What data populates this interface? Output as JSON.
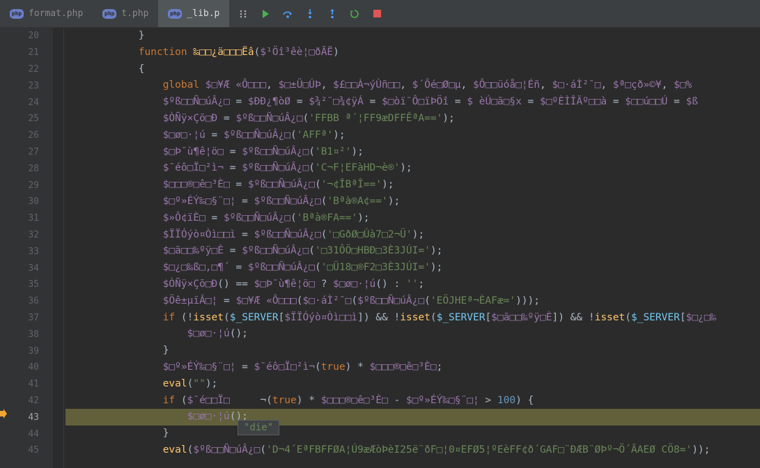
{
  "tabs": [
    {
      "label": "format.php",
      "active": false
    },
    {
      "label": "t.php",
      "active": false
    },
    {
      "label": "_lib.p",
      "active": true
    }
  ],
  "toolbar": {
    "drag": "drag-handle",
    "play": "play",
    "step_over": "step-over",
    "step_into": "step-into",
    "step_out": "step-out",
    "restart": "restart",
    "stop": "stop"
  },
  "gutter_start": 20,
  "current_line": 43,
  "tooltip": "\"die\"",
  "lines": [
    {
      "n": 20,
      "indent": 3,
      "tokens": [
        {
          "t": "}",
          "c": "plain"
        }
      ]
    },
    {
      "n": 21,
      "indent": 3,
      "tokens": [
        {
          "t": "function ",
          "c": "k-keyword"
        },
        {
          "t": "‰□□¿ä□□□Ëâ",
          "c": "k-func"
        },
        {
          "t": "(",
          "c": "plain"
        },
        {
          "t": "$¹Öî³êè¦□ðÃË",
          "c": "k-var"
        },
        {
          "t": ")",
          "c": "plain"
        }
      ]
    },
    {
      "n": 22,
      "indent": 3,
      "tokens": [
        {
          "t": "{",
          "c": "plain"
        }
      ]
    },
    {
      "n": 23,
      "indent": 4,
      "tokens": [
        {
          "t": "global ",
          "c": "k-keyword"
        },
        {
          "t": "$□¥Æ «Ô□□□",
          "c": "k-var"
        },
        {
          "t": ", ",
          "c": "plain"
        },
        {
          "t": "$□±Ü□ÚÞ",
          "c": "k-var"
        },
        {
          "t": ", ",
          "c": "plain"
        },
        {
          "t": "$£□□À¬ýÙñ□□",
          "c": "k-var"
        },
        {
          "t": ", ",
          "c": "plain"
        },
        {
          "t": "$´Ôé□Ø□µ",
          "c": "k-var"
        },
        {
          "t": ", ",
          "c": "plain"
        },
        {
          "t": "$Ô□□üóå□¦Éñ",
          "c": "k-var"
        },
        {
          "t": ", ",
          "c": "plain"
        },
        {
          "t": "$□·áÌ²¯□",
          "c": "k-var"
        },
        {
          "t": ", ",
          "c": "plain"
        },
        {
          "t": "$ª□çð»©¥",
          "c": "k-var"
        },
        {
          "t": ", ",
          "c": "plain"
        },
        {
          "t": "$□%",
          "c": "k-var"
        }
      ]
    },
    {
      "n": 24,
      "indent": 4,
      "tokens": [
        {
          "t": "$ºß□□Ñ□úÂ¿□",
          "c": "k-var"
        },
        {
          "t": " = ",
          "c": "plain"
        },
        {
          "t": "$ÐÐ¿¶òØ",
          "c": "k-var"
        },
        {
          "t": " = ",
          "c": "plain"
        },
        {
          "t": "$¾²¨□¾¢ÿÁ",
          "c": "k-var"
        },
        {
          "t": " = ",
          "c": "plain"
        },
        {
          "t": "$□òï¯Ô□ïÞÖî",
          "c": "k-var"
        },
        {
          "t": " = ",
          "c": "plain"
        },
        {
          "t": "$ èÚ□ã□§x",
          "c": "k-var"
        },
        {
          "t": " = ",
          "c": "plain"
        },
        {
          "t": "$□ºÈÌÎÄº□□à",
          "c": "k-var"
        },
        {
          "t": " = ",
          "c": "plain"
        },
        {
          "t": "$□□ú□□Ú",
          "c": "k-var"
        },
        {
          "t": " = ",
          "c": "plain"
        },
        {
          "t": "$ß",
          "c": "k-var"
        }
      ]
    },
    {
      "n": 25,
      "indent": 4,
      "tokens": [
        {
          "t": "$ÒÑÿ×Çõ□Ð",
          "c": "k-var"
        },
        {
          "t": " = ",
          "c": "plain"
        },
        {
          "t": "$ºß□□Ñ□úÂ¿□",
          "c": "k-var"
        },
        {
          "t": "(",
          "c": "plain"
        },
        {
          "t": "'FFBB ª´¦FF9æDFFÊªA=='",
          "c": "k-string"
        },
        {
          "t": ");",
          "c": "plain"
        }
      ]
    },
    {
      "n": 26,
      "indent": 4,
      "tokens": [
        {
          "t": "$□ø□·¦ú",
          "c": "k-var"
        },
        {
          "t": " = ",
          "c": "plain"
        },
        {
          "t": "$ºß□□Ñ□úÂ¿□",
          "c": "k-var"
        },
        {
          "t": "(",
          "c": "plain"
        },
        {
          "t": "'AFFª'",
          "c": "k-string"
        },
        {
          "t": ");",
          "c": "plain"
        }
      ]
    },
    {
      "n": 27,
      "indent": 4,
      "tokens": [
        {
          "t": "$□Þ¯ù¶ê¦ö□",
          "c": "k-var"
        },
        {
          "t": " = ",
          "c": "plain"
        },
        {
          "t": "$ºß□□Ñ□úÂ¿□",
          "c": "k-var"
        },
        {
          "t": "(",
          "c": "plain"
        },
        {
          "t": "'B1¤²'",
          "c": "k-string"
        },
        {
          "t": ");",
          "c": "plain"
        }
      ]
    },
    {
      "n": 28,
      "indent": 4,
      "tokens": [
        {
          "t": "$¯éô□Ï□²ì¬",
          "c": "k-var"
        },
        {
          "t": " = ",
          "c": "plain"
        },
        {
          "t": "$ºß□□Ñ□úÂ¿□",
          "c": "k-var"
        },
        {
          "t": "(",
          "c": "plain"
        },
        {
          "t": "'C¬F¦EFàHD¬è®'",
          "c": "k-string"
        },
        {
          "t": ");",
          "c": "plain"
        }
      ]
    },
    {
      "n": 29,
      "indent": 4,
      "tokens": [
        {
          "t": "$□□□®□ê□³È□",
          "c": "k-var"
        },
        {
          "t": " = ",
          "c": "plain"
        },
        {
          "t": "$ºß□□Ñ□úÂ¿□",
          "c": "k-var"
        },
        {
          "t": "(",
          "c": "plain"
        },
        {
          "t": "'¬¢ÎBªÎ=='",
          "c": "k-string"
        },
        {
          "t": ");",
          "c": "plain"
        }
      ]
    },
    {
      "n": 30,
      "indent": 4,
      "tokens": [
        {
          "t": "$□º»ÉÝ‰□§¨□¦",
          "c": "k-var"
        },
        {
          "t": " = ",
          "c": "plain"
        },
        {
          "t": "$ºß□□Ñ□úÂ¿□",
          "c": "k-var"
        },
        {
          "t": "(",
          "c": "plain"
        },
        {
          "t": "'Bªà®A¢=='",
          "c": "k-string"
        },
        {
          "t": ");",
          "c": "plain"
        }
      ]
    },
    {
      "n": 31,
      "indent": 4,
      "tokens": [
        {
          "t": "$»Ô¢ïÈ□",
          "c": "k-var"
        },
        {
          "t": " = ",
          "c": "plain"
        },
        {
          "t": "$ºß□□Ñ□úÂ¿□",
          "c": "k-var"
        },
        {
          "t": "(",
          "c": "plain"
        },
        {
          "t": "'Bªà®FA=='",
          "c": "k-string"
        },
        {
          "t": ");",
          "c": "plain"
        }
      ]
    },
    {
      "n": 32,
      "indent": 4,
      "tokens": [
        {
          "t": "$ÏÏÓýò¤Òì□□ì",
          "c": "k-var"
        },
        {
          "t": " = ",
          "c": "plain"
        },
        {
          "t": "$ºß□□Ñ□úÂ¿□",
          "c": "k-var"
        },
        {
          "t": "(",
          "c": "plain"
        },
        {
          "t": "'□GðØ□Úà7□2¬Ü'",
          "c": "k-string"
        },
        {
          "t": ");",
          "c": "plain"
        }
      ]
    },
    {
      "n": 33,
      "indent": 4,
      "tokens": [
        {
          "t": "$□ã□□‰ºÿ□È",
          "c": "k-var"
        },
        {
          "t": " = ",
          "c": "plain"
        },
        {
          "t": "$ºß□□Ñ□úÂ¿□",
          "c": "k-var"
        },
        {
          "t": "(",
          "c": "plain"
        },
        {
          "t": "'□31ÔÖ□HBÐ□3È3JÚI='",
          "c": "k-string"
        },
        {
          "t": ");",
          "c": "plain"
        }
      ]
    },
    {
      "n": 34,
      "indent": 4,
      "tokens": [
        {
          "t": "$□¿□‰ß□,□¶´",
          "c": "k-var"
        },
        {
          "t": " = ",
          "c": "plain"
        },
        {
          "t": "$ºß□□Ñ□úÂ¿□",
          "c": "k-var"
        },
        {
          "t": "(",
          "c": "plain"
        },
        {
          "t": "'□Ü18□®F2□3È3JÚI='",
          "c": "k-string"
        },
        {
          "t": ");",
          "c": "plain"
        }
      ]
    },
    {
      "n": 35,
      "indent": 4,
      "tokens": [
        {
          "t": "$ÒÑÿ×Çõ□Ð",
          "c": "k-var"
        },
        {
          "t": "() == ",
          "c": "plain"
        },
        {
          "t": "$□Þ¯ù¶ê¦ö□",
          "c": "k-var"
        },
        {
          "t": " ? ",
          "c": "plain"
        },
        {
          "t": "$□ø□·¦ú",
          "c": "k-var"
        },
        {
          "t": "() : ",
          "c": "plain"
        },
        {
          "t": "''",
          "c": "k-string"
        },
        {
          "t": ";",
          "c": "plain"
        }
      ]
    },
    {
      "n": 36,
      "indent": 4,
      "tokens": [
        {
          "t": "$Öê±µïÂ□¦",
          "c": "k-var"
        },
        {
          "t": " = ",
          "c": "plain"
        },
        {
          "t": "$□¥Æ «Ô□□□",
          "c": "k-var"
        },
        {
          "t": "(",
          "c": "plain"
        },
        {
          "t": "$□·áÌ²¯□",
          "c": "k-var"
        },
        {
          "t": "(",
          "c": "plain"
        },
        {
          "t": "$ºß□□Ñ□úÂ¿□",
          "c": "k-var"
        },
        {
          "t": "(",
          "c": "plain"
        },
        {
          "t": "'EÖJHEª¬ÈAFæ='",
          "c": "k-string"
        },
        {
          "t": ")));",
          "c": "plain"
        }
      ]
    },
    {
      "n": 37,
      "indent": 4,
      "tokens": [
        {
          "t": "if ",
          "c": "k-keyword"
        },
        {
          "t": "(!",
          "c": "plain"
        },
        {
          "t": "isset",
          "c": "k-func"
        },
        {
          "t": "(",
          "c": "plain"
        },
        {
          "t": "$_SERVER",
          "c": "k-super"
        },
        {
          "t": "[",
          "c": "plain"
        },
        {
          "t": "$ÏÏÓýò¤Òì□□ì",
          "c": "k-var"
        },
        {
          "t": "]) && !",
          "c": "plain"
        },
        {
          "t": "isset",
          "c": "k-func"
        },
        {
          "t": "(",
          "c": "plain"
        },
        {
          "t": "$_SERVER",
          "c": "k-super"
        },
        {
          "t": "[",
          "c": "plain"
        },
        {
          "t": "$□ã□□‰ºÿ□È",
          "c": "k-var"
        },
        {
          "t": "]) && !",
          "c": "plain"
        },
        {
          "t": "isset",
          "c": "k-func"
        },
        {
          "t": "(",
          "c": "plain"
        },
        {
          "t": "$_SERVER",
          "c": "k-super"
        },
        {
          "t": "[",
          "c": "plain"
        },
        {
          "t": "$□¿□‰",
          "c": "k-var"
        }
      ]
    },
    {
      "n": 38,
      "indent": 5,
      "tokens": [
        {
          "t": "$□ø□·¦ú",
          "c": "k-var"
        },
        {
          "t": "();",
          "c": "plain"
        }
      ]
    },
    {
      "n": 39,
      "indent": 4,
      "tokens": [
        {
          "t": "}",
          "c": "plain"
        }
      ]
    },
    {
      "n": 40,
      "indent": 4,
      "tokens": [
        {
          "t": "$□º»ÉÝ‰□§¨□¦",
          "c": "k-var"
        },
        {
          "t": " = ",
          "c": "plain"
        },
        {
          "t": "$¯éô□Ï□²ì¬",
          "c": "k-var"
        },
        {
          "t": "(",
          "c": "plain"
        },
        {
          "t": "true",
          "c": "k-keyword"
        },
        {
          "t": ") * ",
          "c": "plain"
        },
        {
          "t": "$□□□®□ê□³È□",
          "c": "k-var"
        },
        {
          "t": ";",
          "c": "plain"
        }
      ]
    },
    {
      "n": 41,
      "indent": 4,
      "tokens": [
        {
          "t": "eval",
          "c": "k-func"
        },
        {
          "t": "(",
          "c": "plain"
        },
        {
          "t": "\"\"",
          "c": "k-string"
        },
        {
          "t": ");",
          "c": "plain"
        }
      ]
    },
    {
      "n": 42,
      "indent": 4,
      "tokens": [
        {
          "t": "if ",
          "c": "k-keyword"
        },
        {
          "t": "(",
          "c": "plain"
        },
        {
          "t": "$¯é□□Ï□",
          "c": "k-var"
        },
        {
          "t": "     ¬(",
          "c": "plain"
        },
        {
          "t": "true",
          "c": "k-keyword"
        },
        {
          "t": ") * ",
          "c": "plain"
        },
        {
          "t": "$□□□®□ê□³È□",
          "c": "k-var"
        },
        {
          "t": " - ",
          "c": "plain"
        },
        {
          "t": "$□º»ÉÝ‰□§¨□¦",
          "c": "k-var"
        },
        {
          "t": " > ",
          "c": "plain"
        },
        {
          "t": "100",
          "c": "k-num"
        },
        {
          "t": ") {",
          "c": "plain"
        }
      ]
    },
    {
      "n": 43,
      "indent": 5,
      "hl": true,
      "tokens": [
        {
          "t": "$□ø□·¦ú",
          "c": "k-var"
        },
        {
          "t": "();",
          "c": "plain"
        }
      ]
    },
    {
      "n": 44,
      "indent": 4,
      "tokens": [
        {
          "t": "}",
          "c": "plain"
        }
      ]
    },
    {
      "n": 45,
      "indent": 4,
      "tokens": [
        {
          "t": "eval",
          "c": "k-func"
        },
        {
          "t": "(",
          "c": "plain"
        },
        {
          "t": "$ºß□□Ñ□úÂ¿□",
          "c": "k-var"
        },
        {
          "t": "(",
          "c": "plain"
        },
        {
          "t": "'D¬4´EªFBFFØA¦Ú9æÆòÞèI25ë¨ðF□¦0¤EFØ5¦ºEèFF¢ð´GAF□¨ÐÆB¨ØÞº¬Ö´ÄAEØ CÖ8='",
          "c": "k-string"
        },
        {
          "t": "));",
          "c": "plain"
        }
      ]
    }
  ]
}
